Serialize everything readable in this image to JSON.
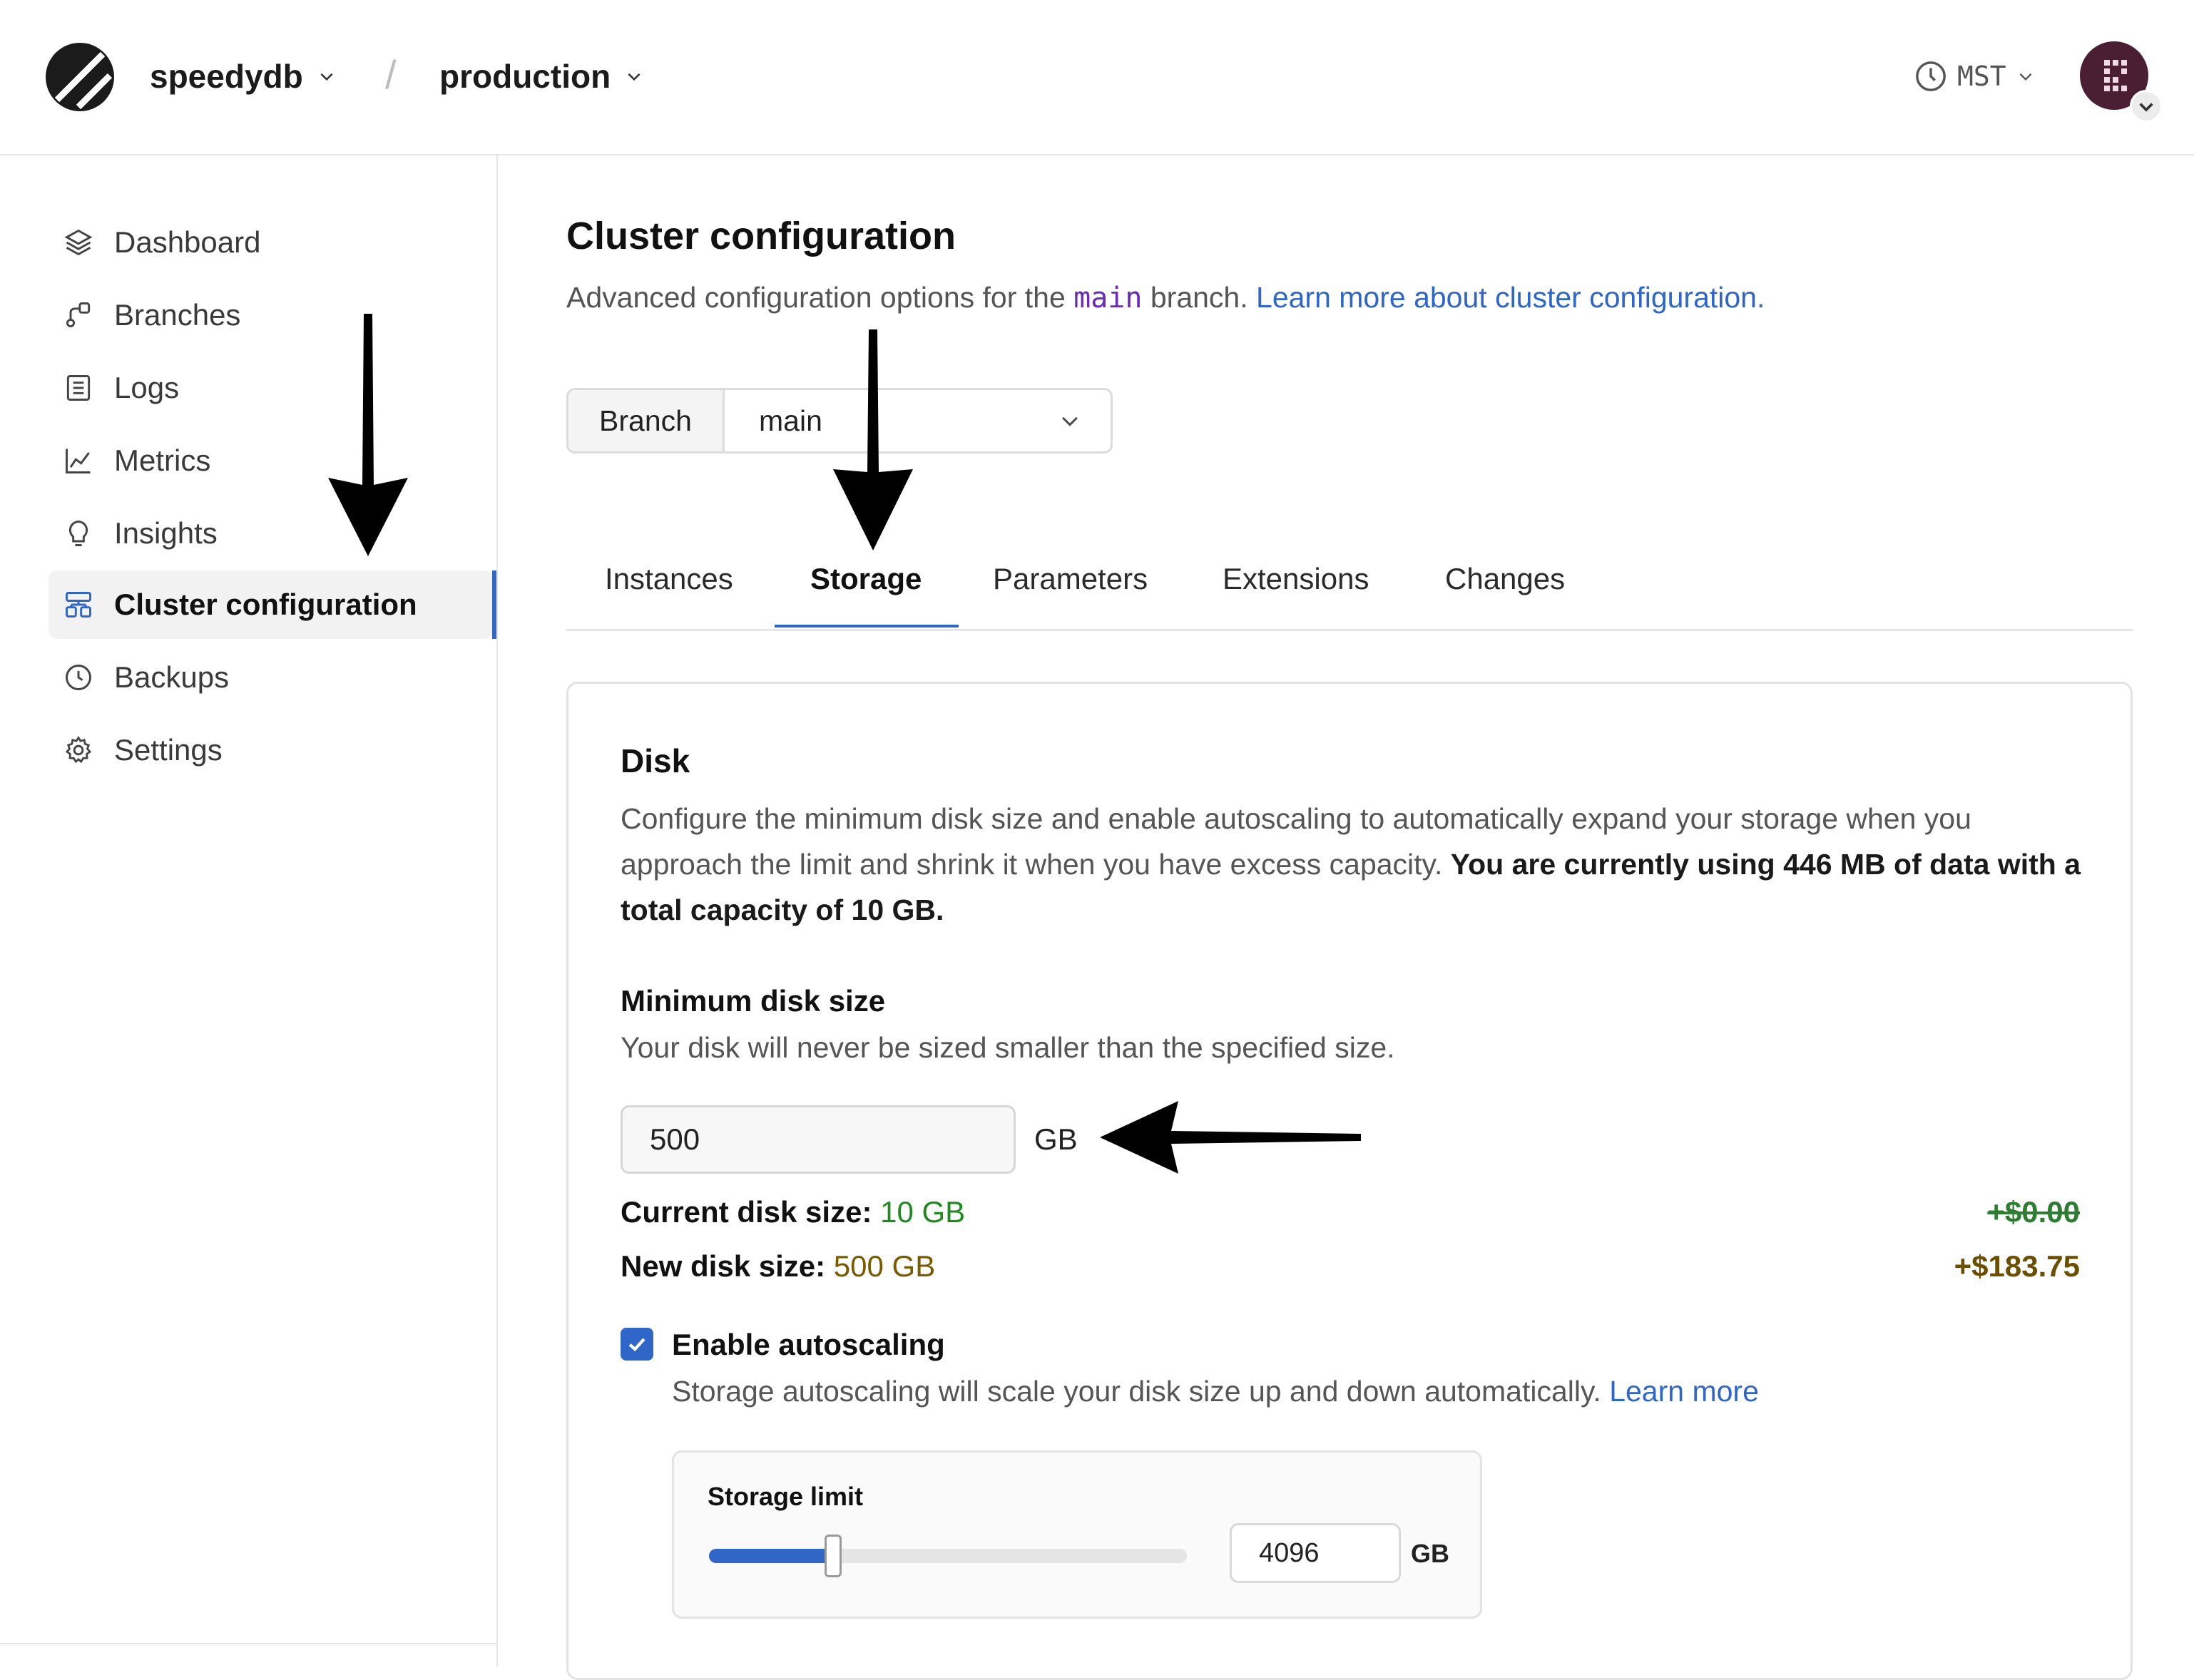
{
  "header": {
    "org": "speedydb",
    "separator": "/",
    "database": "production",
    "timezone": "MST",
    "logo_icon": "planetscale-logo-icon",
    "avatar_icon": "user-avatar-icon"
  },
  "sidebar": {
    "items": [
      {
        "label": "Dashboard",
        "icon": "layers-icon"
      },
      {
        "label": "Branches",
        "icon": "branch-icon"
      },
      {
        "label": "Logs",
        "icon": "logs-icon"
      },
      {
        "label": "Metrics",
        "icon": "metrics-icon"
      },
      {
        "label": "Insights",
        "icon": "lightbulb-icon"
      },
      {
        "label": "Cluster configuration",
        "icon": "cluster-icon",
        "active": true
      },
      {
        "label": "Backups",
        "icon": "clock-icon"
      },
      {
        "label": "Settings",
        "icon": "gear-icon"
      }
    ]
  },
  "main": {
    "title": "Cluster configuration",
    "subtitle_pre": "Advanced configuration options for the ",
    "subtitle_branch": "main",
    "subtitle_post": " branch. ",
    "subtitle_link": "Learn more about cluster configuration.",
    "branch_label": "Branch",
    "branch_value": "main",
    "tabs": [
      {
        "label": "Instances"
      },
      {
        "label": "Storage",
        "active": true
      },
      {
        "label": "Parameters"
      },
      {
        "label": "Extensions"
      },
      {
        "label": "Changes"
      }
    ],
    "disk": {
      "title": "Disk",
      "desc_plain": "Configure the minimum disk size and enable autoscaling to automatically expand your storage when you approach the limit and shrink it when you have excess capacity. ",
      "desc_bold": "You are currently using 446 MB of data with a total capacity of 10 GB.",
      "min_title": "Minimum disk size",
      "min_desc": "Your disk will never be sized smaller than the specified size.",
      "min_value": "500",
      "unit": "GB",
      "current_label": "Current disk size: ",
      "current_value": "10 GB",
      "current_price": "+$0.00",
      "new_label": "New disk size: ",
      "new_value": "500 GB",
      "new_price": "+$183.75"
    },
    "autoscaling": {
      "checked": true,
      "label": "Enable autoscaling",
      "desc": "Storage autoscaling will scale your disk size up and down automatically. ",
      "link": "Learn more",
      "limit_title": "Storage limit",
      "limit_value": "4096",
      "limit_unit": "GB",
      "slider_fraction": 0.26
    }
  },
  "colors": {
    "accent": "#2f66c8",
    "current_green": "#1f8a1f",
    "new_olive": "#7a5a00"
  }
}
